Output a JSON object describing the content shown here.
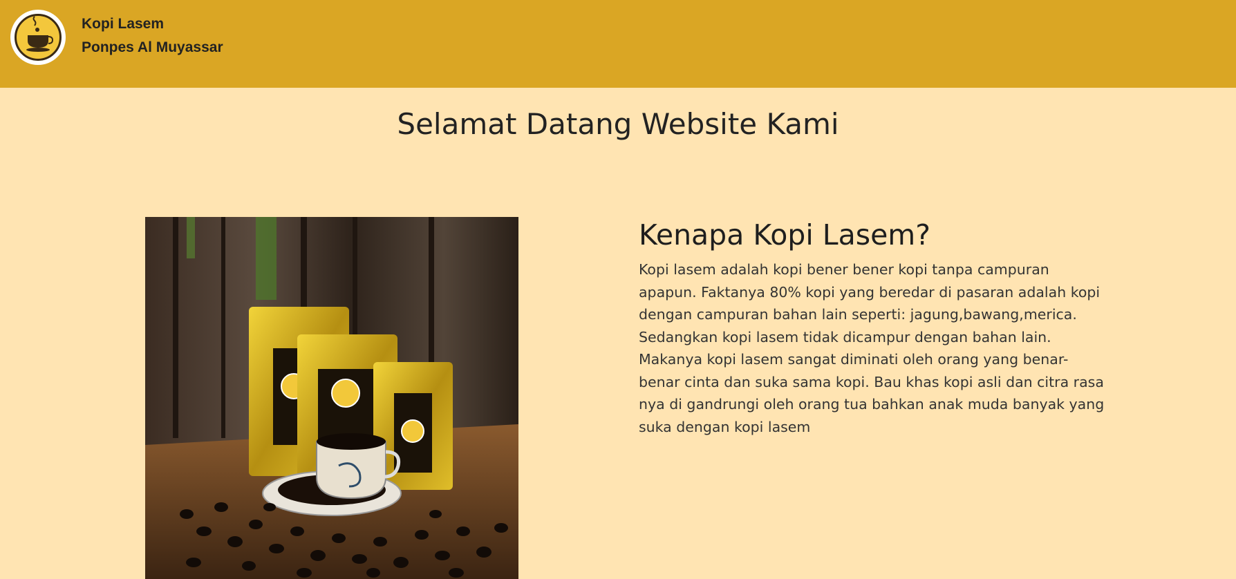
{
  "navbar": {
    "brand_line1": "Kopi Lasem",
    "brand_line2": "Ponpes Al Muyassar",
    "logo_icon": "coffee-cup-logo-icon",
    "background_color": "#daa624"
  },
  "hero": {
    "heading": "Selamat Datang Website Kami"
  },
  "about": {
    "image_subject": "coffee-packages-with-cup-and-beans-photo",
    "title": "Kenapa Kopi Lasem?",
    "body": "Kopi lasem adalah kopi bener bener kopi tanpa campuran apapun. Faktanya 80% kopi yang beredar di pasaran adalah kopi dengan campuran bahan lain seperti: jagung,bawang,merica. Sedangkan kopi lasem tidak dicampur dengan bahan lain. Makanya kopi lasem sangat diminati oleh orang yang benar-benar cinta dan suka sama kopi. Bau khas kopi asli dan citra rasa nya di gandrungi oleh orang tua bahkan anak muda banyak yang suka dengan kopi lasem"
  },
  "colors": {
    "page_background": "#ffe4b2",
    "accent_gold": "#daa624"
  }
}
